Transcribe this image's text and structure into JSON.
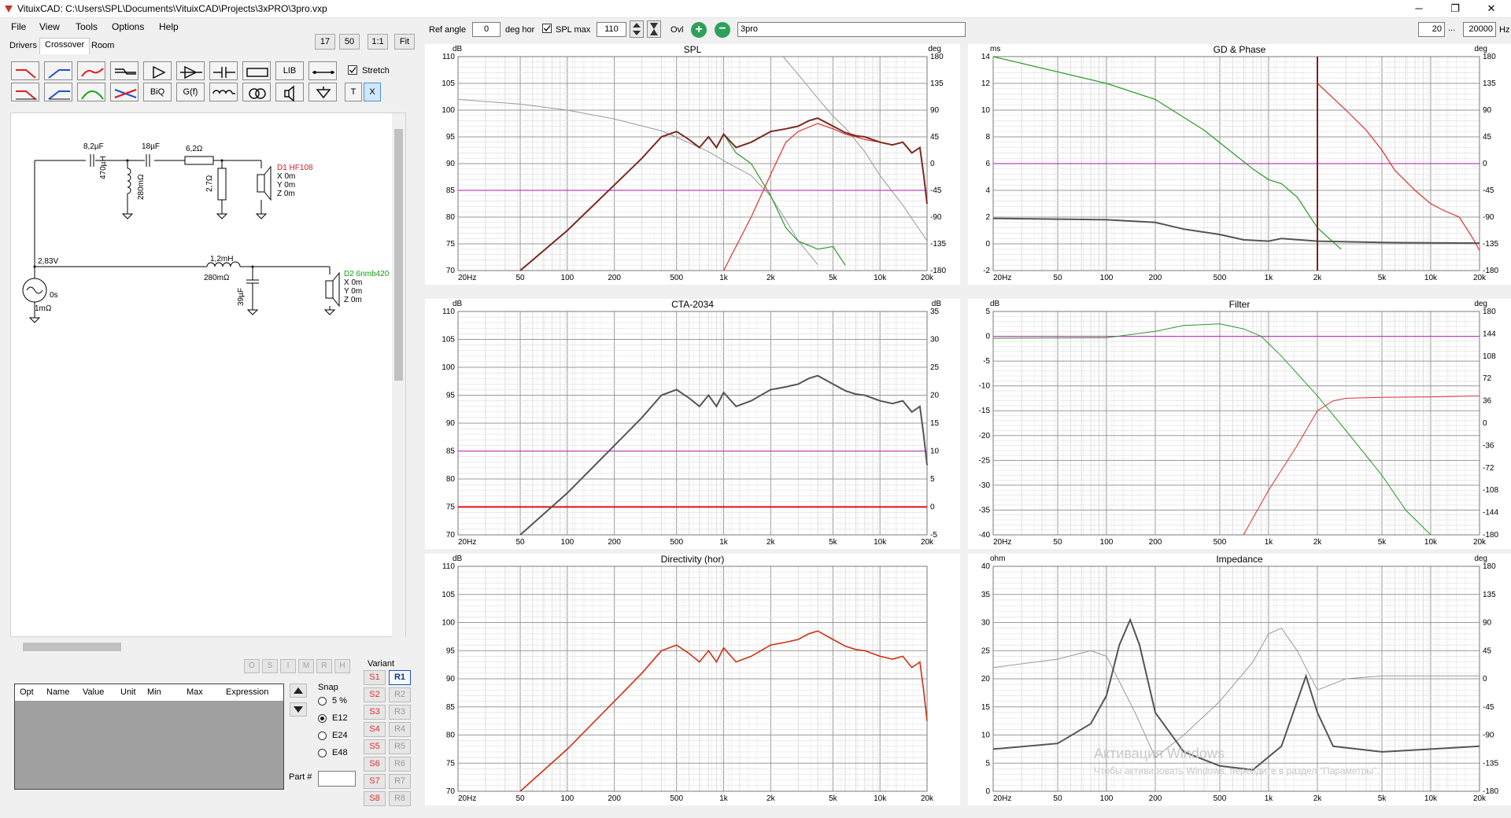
{
  "window": {
    "title": "VituixCAD: C:\\Users\\SPL\\Documents\\VituixCAD\\Projects\\3xPRO\\3pro.vxp",
    "minimize": "─",
    "maximize": "❐",
    "close": "✕"
  },
  "menu": [
    "File",
    "View",
    "Tools",
    "Options",
    "Help"
  ],
  "tabs": [
    "Drivers",
    "Crossover",
    "Room"
  ],
  "zoom_buttons": [
    "17",
    "50",
    "1:1",
    "Fit"
  ],
  "components_row1": [
    "lp1",
    "hp1",
    "bp1",
    "shelf",
    "buffer",
    "amp",
    "cap-series",
    "resistor",
    "LIB",
    "wire"
  ],
  "components_row2": [
    "lp2",
    "hp2",
    "bp2",
    "notch",
    "BiQ",
    "G(f)",
    "inductor",
    "transformer",
    "driver",
    "ground",
    "T",
    "X"
  ],
  "stretch_label": "Stretch",
  "schematic": {
    "c1": "8,2µF",
    "c2": "18µF",
    "r1": "6,2Ω",
    "l1": "470µH",
    "l1r": "280mΩ",
    "r2": "2,7Ω",
    "d1_name": "D1 HF108",
    "d1_x": "X 0m",
    "d1_y": "Y 0m",
    "d1_z": "Z 0m",
    "source_v": "2,83V",
    "source_t": "0s",
    "source_r": "1mΩ",
    "l2": "1,2mH",
    "l2r": "280mΩ",
    "c3": "39µF",
    "d2_name": "D2 6nmb420",
    "d2_x": "X 0m",
    "d2_y": "Y 0m",
    "d2_z": "Z 0m"
  },
  "opt_buttons": [
    "O",
    "S",
    "I",
    "M",
    "R",
    "H"
  ],
  "table_headers": [
    "Opt",
    "Name",
    "Value",
    "Unit",
    "Min",
    "Max",
    "Expression"
  ],
  "snap": {
    "label": "Snap",
    "options": [
      "5 %",
      "E12",
      "E24",
      "E48"
    ],
    "selected": "E12"
  },
  "variant": {
    "label": "Variant",
    "s": [
      "S1",
      "S2",
      "S3",
      "S4",
      "S5",
      "S6",
      "S7",
      "S8"
    ],
    "r": [
      "R1",
      "R2",
      "R3",
      "R4",
      "R5",
      "R6",
      "R7",
      "R8"
    ],
    "selected": "R1"
  },
  "part_label": "Part #",
  "toolbar": {
    "ref_angle_label": "Ref angle",
    "ref_angle": "0",
    "deg_hor": "deg hor",
    "spl_max_label": "SPL max",
    "spl_max": "110",
    "ovl": "Ovl",
    "plus": "+",
    "minus": "−",
    "name": "3pro",
    "f_min": "20",
    "dots": "...",
    "f_max": "20000",
    "hz": "Hz"
  },
  "graphs": {
    "spl": {
      "title": "SPL",
      "left_unit": "dB",
      "right_unit": "deg"
    },
    "gd": {
      "title": "GD & Phase",
      "left_unit": "ms",
      "right_unit": "deg"
    },
    "cta": {
      "title": "CTA-2034",
      "left_unit": "dB",
      "right_unit": "dB"
    },
    "filter": {
      "title": "Filter",
      "left_unit": "dB",
      "right_unit": "deg"
    },
    "dir": {
      "title": "Directivity (hor)",
      "left_unit": "dB"
    },
    "imp": {
      "title": "Impedance",
      "left_unit": "ohm",
      "right_unit": "deg"
    }
  },
  "x_ticks": [
    "20Hz",
    "50",
    "100",
    "200",
    "500",
    "1k",
    "2k",
    "5k",
    "10k",
    "20k"
  ],
  "watermark": {
    "line1": "Активация Windows",
    "line2": "Чтобы активировать Windows, перейдите в раздел \"Параметры\"."
  }
}
